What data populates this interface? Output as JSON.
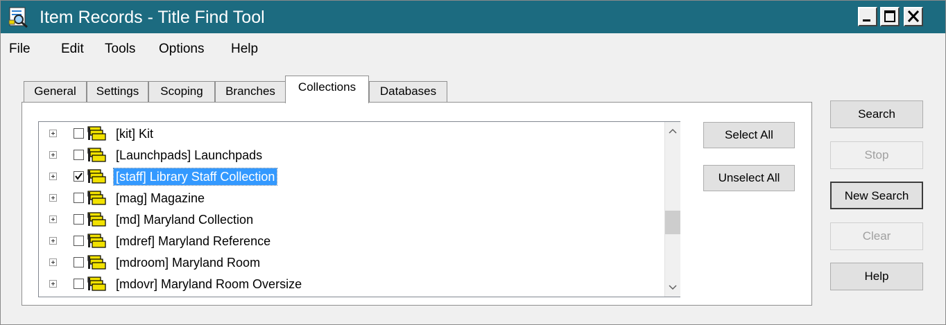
{
  "window": {
    "title": "Item Records - Title Find Tool",
    "app_icon": "search-tool-icon",
    "controls": [
      "minimize-icon",
      "maximize-icon",
      "close-icon"
    ]
  },
  "menubar": {
    "items": [
      "File",
      "Edit",
      "Tools",
      "Options",
      "Help"
    ]
  },
  "tabs": {
    "items": [
      "General",
      "Settings",
      "Scoping",
      "Branches",
      "Collections",
      "Databases"
    ],
    "active": "Collections"
  },
  "collections": {
    "items": [
      {
        "label": "[kit] Kit",
        "checked": false,
        "selected": false
      },
      {
        "label": "[Launchpads] Launchpads",
        "checked": false,
        "selected": false
      },
      {
        "label": "[staff] Library Staff Collection",
        "checked": true,
        "selected": true
      },
      {
        "label": "[mag] Magazine",
        "checked": false,
        "selected": false
      },
      {
        "label": "[md] Maryland Collection",
        "checked": false,
        "selected": false
      },
      {
        "label": "[mdref] Maryland Reference",
        "checked": false,
        "selected": false
      },
      {
        "label": "[mdroom] Maryland Room",
        "checked": false,
        "selected": false
      },
      {
        "label": "[mdovr] Maryland Room Oversize",
        "checked": false,
        "selected": false
      }
    ],
    "select_all_label": "Select All",
    "unselect_all_label": "Unselect All"
  },
  "actions": {
    "search_label": "Search",
    "stop_label": "Stop",
    "new_search_label": "New Search",
    "clear_label": "Clear",
    "help_label": "Help",
    "stop_enabled": false,
    "clear_enabled": false
  },
  "colors": {
    "titlebar": "#1c6b80",
    "selection": "#3399ff",
    "folder_yellow": "#f2e200"
  }
}
